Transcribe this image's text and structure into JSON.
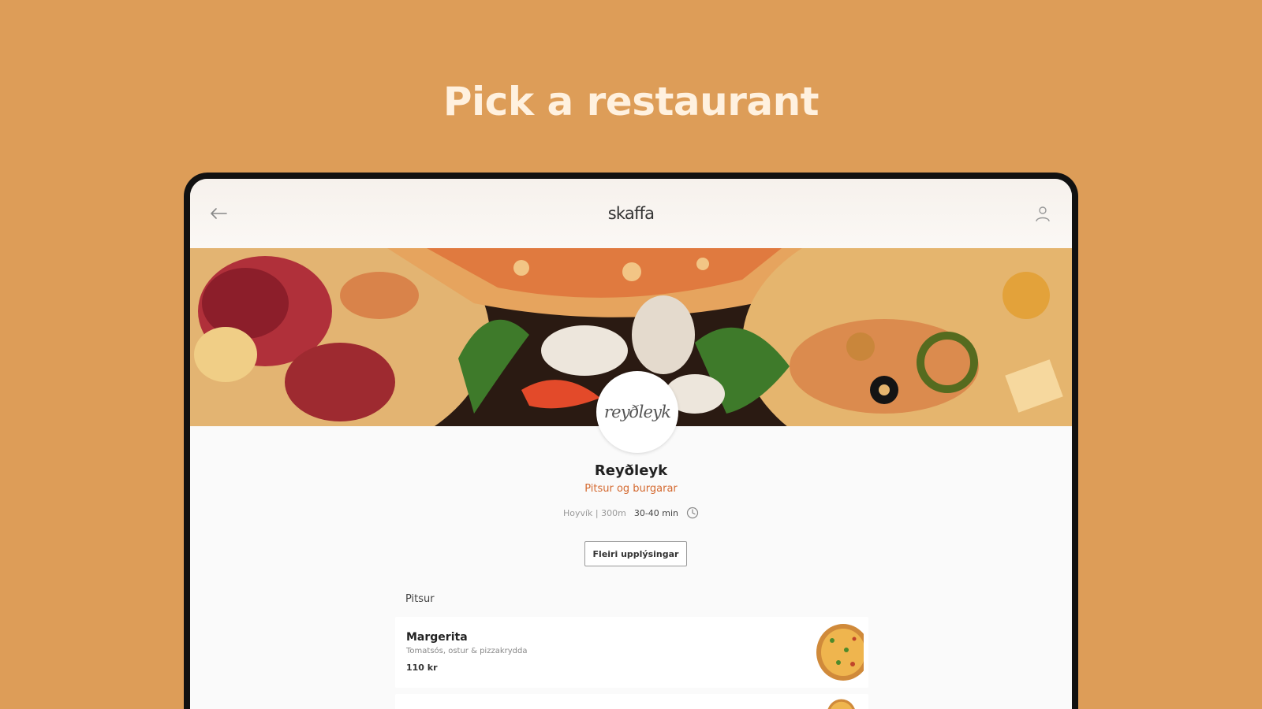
{
  "headline": "Pick a restaurant",
  "app": {
    "brand": "skaffa",
    "back_icon": "arrow-left-icon",
    "user_icon": "user-icon"
  },
  "restaurant": {
    "logo_text": "reyðleyk",
    "name": "Reyðleyk",
    "category": "Pitsur og burgarar",
    "location": "Hoyvík | 300m",
    "delivery_time": "30-40 min",
    "more_info_label": "Fleiri upplýsingar"
  },
  "menu": {
    "section_title": "Pitsur",
    "items": [
      {
        "name": "Margerita",
        "description": "Tomatsós, ostur & pizzakrydda",
        "price": "110 kr"
      }
    ]
  },
  "colors": {
    "background": "#DD9D58",
    "headline": "#FFF1DF",
    "accent": "#D4692F"
  }
}
